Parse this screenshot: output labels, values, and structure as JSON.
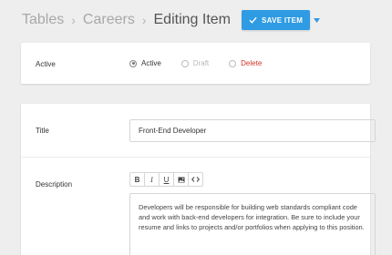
{
  "breadcrumb": {
    "items": [
      "Tables",
      "Careers"
    ],
    "current": "Editing Item",
    "separator": "›"
  },
  "save_button": {
    "label": "SAVE ITEM",
    "icon": "check-icon"
  },
  "status": {
    "label": "Active",
    "options": [
      {
        "label": "Active",
        "checked": true
      },
      {
        "label": "Draft",
        "checked": false
      },
      {
        "label": "Delete",
        "checked": false
      }
    ]
  },
  "title_field": {
    "label": "Title",
    "value": "Front-End Developer"
  },
  "description_field": {
    "label": "Description",
    "toolbar": [
      "B",
      "I",
      "U",
      "image-icon",
      "code-icon"
    ],
    "value": "Developers will be responsible for building web standards compliant code and work with back-end developers for integration. Be sure to include your resume and links to projects and/or portfolios when applying to this position."
  },
  "colors": {
    "accent": "#2f9be3",
    "delete": "#d0342c",
    "background": "#eeeeee"
  }
}
